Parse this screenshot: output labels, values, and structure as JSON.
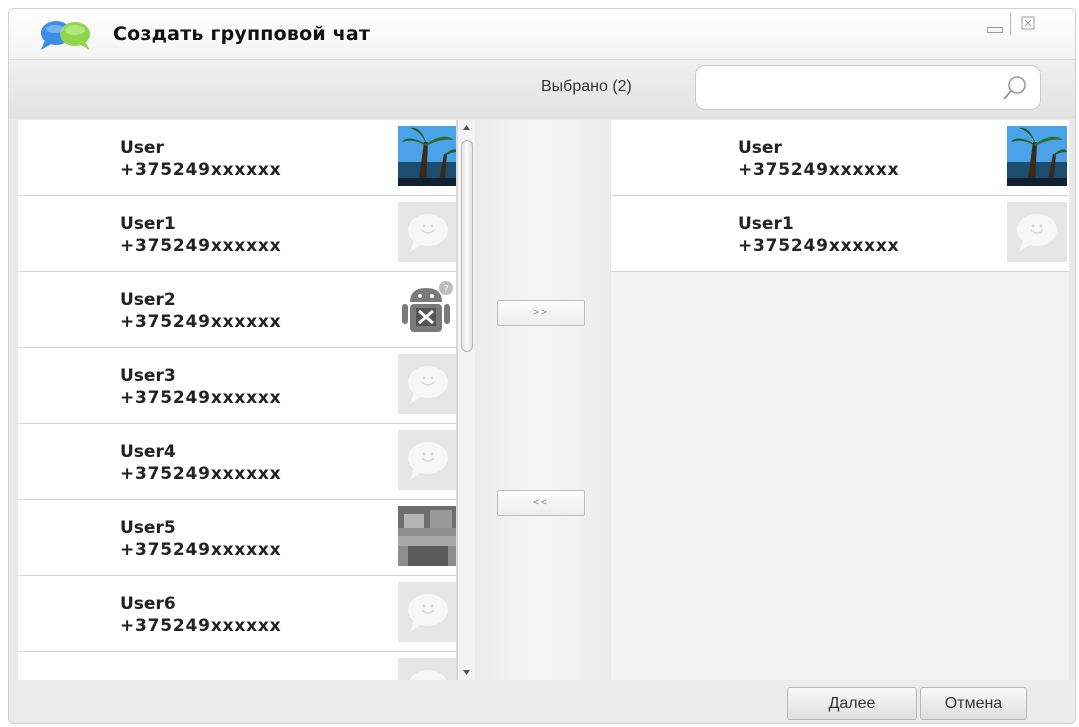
{
  "window": {
    "title": "Создать групповой чат",
    "controls": {
      "minimize": "minimize-icon",
      "close": "close-icon"
    }
  },
  "toolbar": {
    "selected_label": "Выбрано (2)",
    "search": {
      "placeholder": "",
      "value": "",
      "icon": "search-icon"
    }
  },
  "contacts": [
    {
      "name": "User",
      "phone": "+375249xxxxxx",
      "avatar": "photo-beach"
    },
    {
      "name": "User1",
      "phone": "+375249xxxxxx",
      "avatar": "default-chat-bubble"
    },
    {
      "name": "User2",
      "phone": "+375249xxxxxx",
      "avatar": "android-tools"
    },
    {
      "name": "User3",
      "phone": "+375249xxxxxx",
      "avatar": "default-chat-bubble"
    },
    {
      "name": "User4",
      "phone": "+375249xxxxxx",
      "avatar": "default-chat-bubble"
    },
    {
      "name": "User5",
      "phone": "+375249xxxxxx",
      "avatar": "photo-gray"
    },
    {
      "name": "User6",
      "phone": "+375249xxxxxx",
      "avatar": "default-chat-bubble"
    }
  ],
  "selected": [
    {
      "name": "User",
      "phone": "+375249xxxxxx",
      "avatar": "photo-beach"
    },
    {
      "name": "User1",
      "phone": "+375249xxxxxx",
      "avatar": "default-chat-bubble"
    }
  ],
  "transfer": {
    "add_label": ">>",
    "remove_label": "<<"
  },
  "footer": {
    "next_label": "Далее",
    "cancel_label": "Отмена"
  },
  "colors": {
    "window_bg": "#e9e9e9",
    "panel_bg": "#ffffff",
    "divider": "#d8d8d8",
    "text": "#222222"
  }
}
